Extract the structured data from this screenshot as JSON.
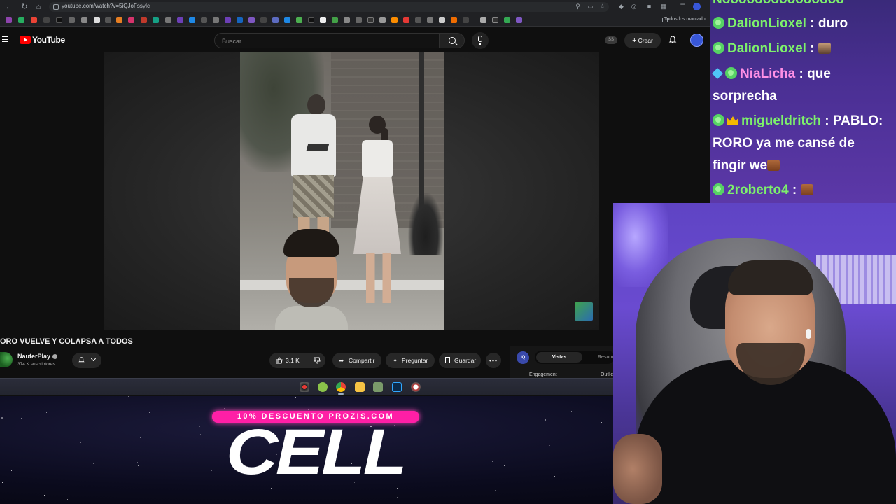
{
  "browser": {
    "url": "youtube.com/watch?v=5iQJoFssyIc",
    "bookmarks_all_label": "Todos los marcador"
  },
  "youtube": {
    "brand": "YouTube",
    "search_placeholder": "Buscar",
    "ss_badge": "SS",
    "create_label": "Crear"
  },
  "video": {
    "title": "ORO VUELVE Y COLAPSA A TODOS",
    "channel": "NauterPlay",
    "subscribers": "374 K suscriptores",
    "likes": "3,1 K",
    "share_label": "Compartir",
    "ask_label": "Preguntar",
    "save_label": "Guardar"
  },
  "extension": {
    "logo": "IQ",
    "tab_views": "Vistas",
    "tab_summary": "Resum",
    "engagement": "Engagement",
    "outlier": "Outlie"
  },
  "promo": {
    "badge": "10% DESCUENTO PROZIS.COM",
    "word": "CELL"
  },
  "chat": {
    "lines": [
      {
        "name": "DalionLioxel",
        "text": "duro"
      },
      {
        "name": "DalionLioxel",
        "text": ""
      },
      {
        "name": "NiaLicha",
        "text": "que"
      },
      {
        "name": "",
        "text": "sorprecha"
      },
      {
        "name": "migueldritch",
        "text": "PABLO:"
      },
      {
        "name": "",
        "text": "RORO ya me cansé de"
      },
      {
        "name": "",
        "text": "fingir we"
      },
      {
        "name": "2roberto4",
        "text": ""
      }
    ]
  },
  "colors": {
    "yt_red": "#ff0000",
    "chat_name_green": "#7df06b",
    "chat_name_pink": "#ff90e6",
    "promo_pink": "#ff1fa6"
  }
}
